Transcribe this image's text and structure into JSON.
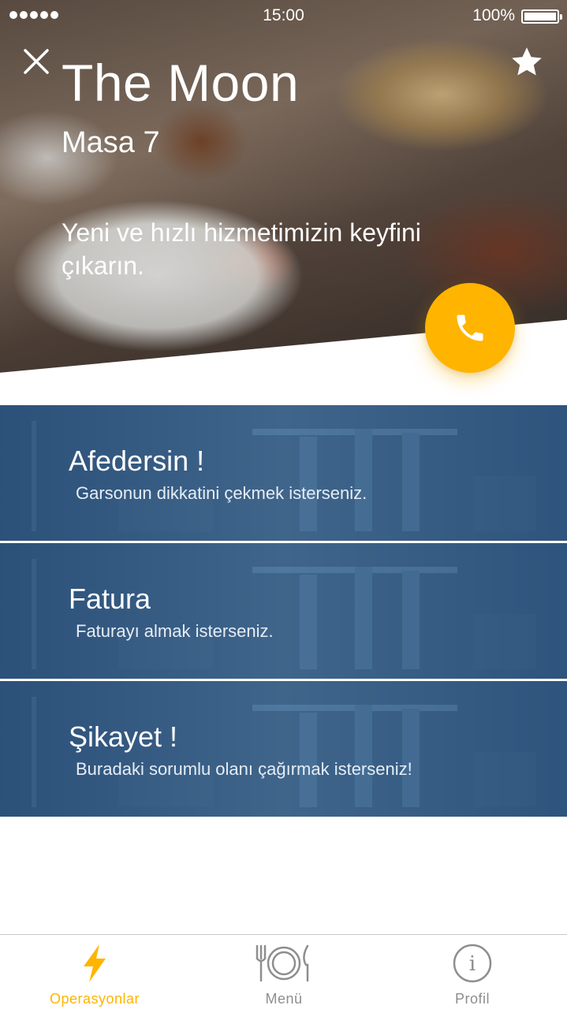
{
  "status_bar": {
    "time": "15:00",
    "battery": "100%"
  },
  "hero": {
    "restaurant_name": "The Moon",
    "table": "Masa 7",
    "tagline": "Yeni ve hızlı hizmetimizin keyfini çıkarın."
  },
  "options": [
    {
      "title": "Afedersin !",
      "subtitle": "Garsonun dikkatini çekmek isterseniz."
    },
    {
      "title": "Fatura",
      "subtitle": "Faturayı almak isterseniz."
    },
    {
      "title": "Şikayet !",
      "subtitle": "Buradaki sorumlu olanı çağırmak isterseniz!"
    }
  ],
  "tabs": [
    {
      "label": "Operasyonlar",
      "icon": "lightning-icon",
      "active": true
    },
    {
      "label": "Menü",
      "icon": "plate-cutlery-icon",
      "active": false
    },
    {
      "label": "Profil",
      "icon": "info-icon",
      "active": false
    }
  ],
  "colors": {
    "accent": "#ffb400",
    "option_overlay": "#1e426c",
    "tab_inactive": "#8e8e8e"
  }
}
